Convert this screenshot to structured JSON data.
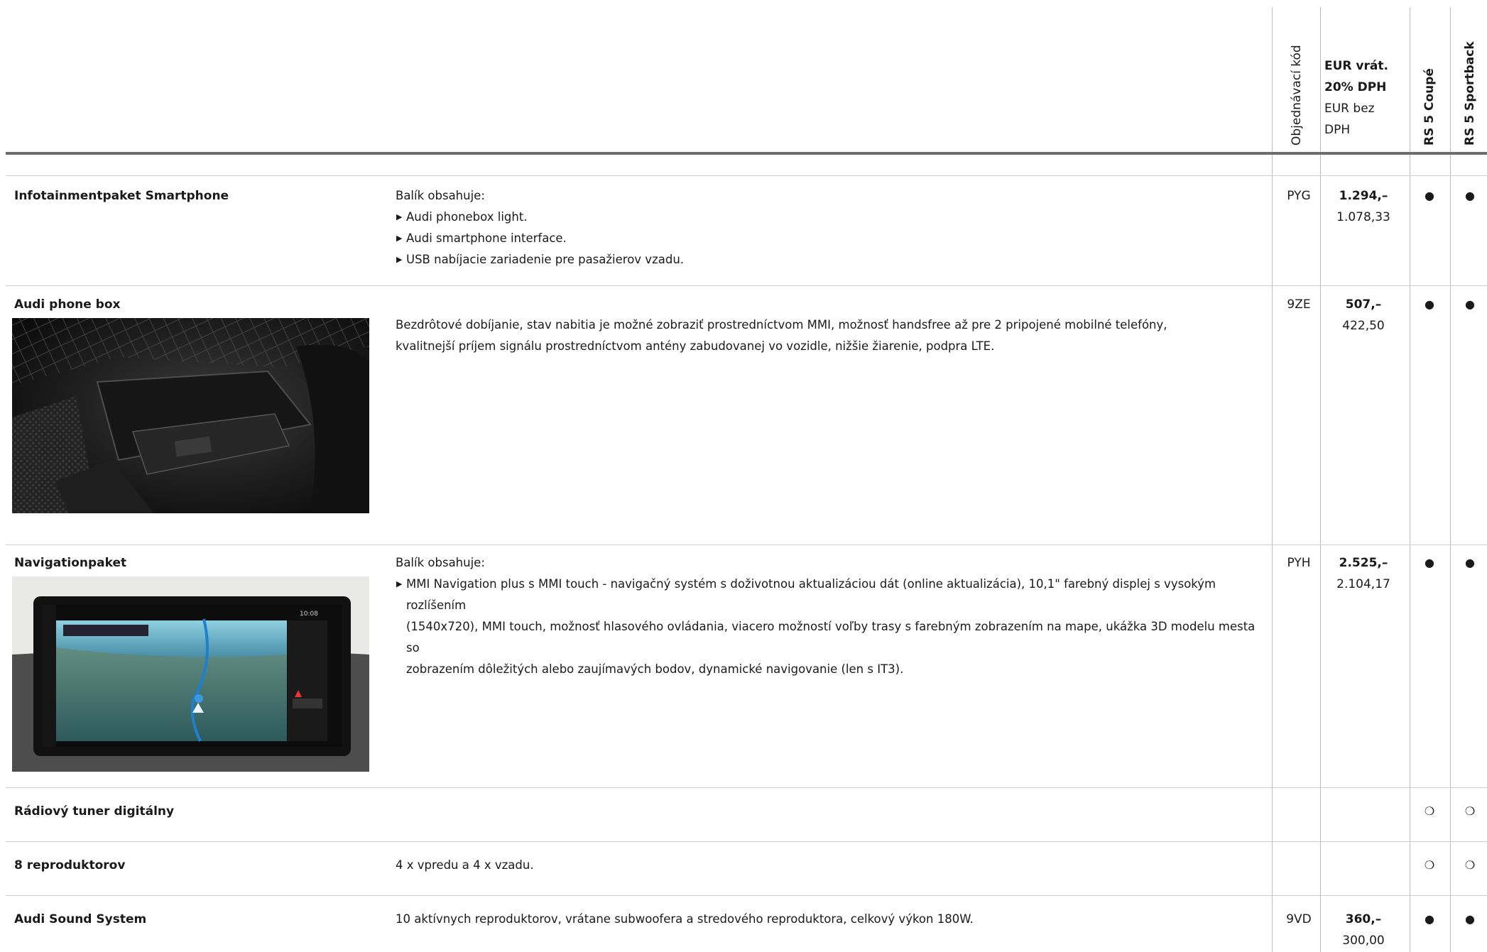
{
  "header": {
    "col_code": "Objednávací kód",
    "price_gross_line1": "EUR vrát.",
    "price_gross_line2": "20% DPH",
    "price_net_line1": "EUR bez",
    "price_net_line2": "DPH",
    "model_1": "RS 5 Coupé",
    "model_2": "RS 5 Sportback"
  },
  "rows": [
    {
      "title": "Infotainmentpaket Smartphone",
      "intro": "Balík obsahuje:",
      "items": [
        "Audi phonebox light.",
        "Audi smartphone interface.",
        "USB nabíjacie zariadenie pre pasažierov vzadu."
      ],
      "code": "PYG",
      "price_gross": "1.294,–",
      "price_net": "1.078,33",
      "coupe": "●",
      "sportback": "●"
    },
    {
      "title": "Audi phone box",
      "desc_line1": "Bezdrôtové dobíjanie, stav nabitia je možné zobraziť prostredníctvom MMI, možnosť handsfree až pre 2 pripojené mobilné telefóny,",
      "desc_line2": "kvalitnejší príjem signálu prostredníctvom antény zabudovanej vo vozidle, nižšie žiarenie, podpra LTE.",
      "code": "9ZE",
      "price_gross": "507,–",
      "price_net": "422,50",
      "coupe": "●",
      "sportback": "●"
    },
    {
      "title": "Navigationpaket",
      "intro": "Balík obsahuje:",
      "item_line1": "MMI Navigation plus s MMI touch - navigačný systém s doživotnou aktualizáciou dát (online aktualizácia), 10,1\" farebný displej s vysokým rozlíšením",
      "item_line2": "(1540x720), MMI touch, možnosť hlasového ovládania, viacero možností voľby trasy s farebným zobrazením na mape, ukážka 3D modelu mesta so",
      "item_line3": "zobrazením dôležitých alebo zaujímavých bodov, dynamické navigovanie (len s IT3).",
      "code": "PYH",
      "price_gross": "2.525,–",
      "price_net": "2.104,17",
      "coupe": "●",
      "sportback": "●"
    },
    {
      "title": "Rádiový tuner digitálny",
      "coupe": "❍",
      "sportback": "❍"
    },
    {
      "title": "8 reproduktorov",
      "desc": "4 x vpredu a 4 x vzadu.",
      "coupe": "❍",
      "sportback": "❍"
    },
    {
      "title": "Audi Sound System",
      "desc": "10 aktívnych reproduktorov, vrátane subwoofera a stredového reproduktora, celkový výkon 180W.",
      "code": "9VD",
      "price_gross": "360,–",
      "price_net": "300,00",
      "coupe": "●",
      "sportback": "●"
    }
  ]
}
